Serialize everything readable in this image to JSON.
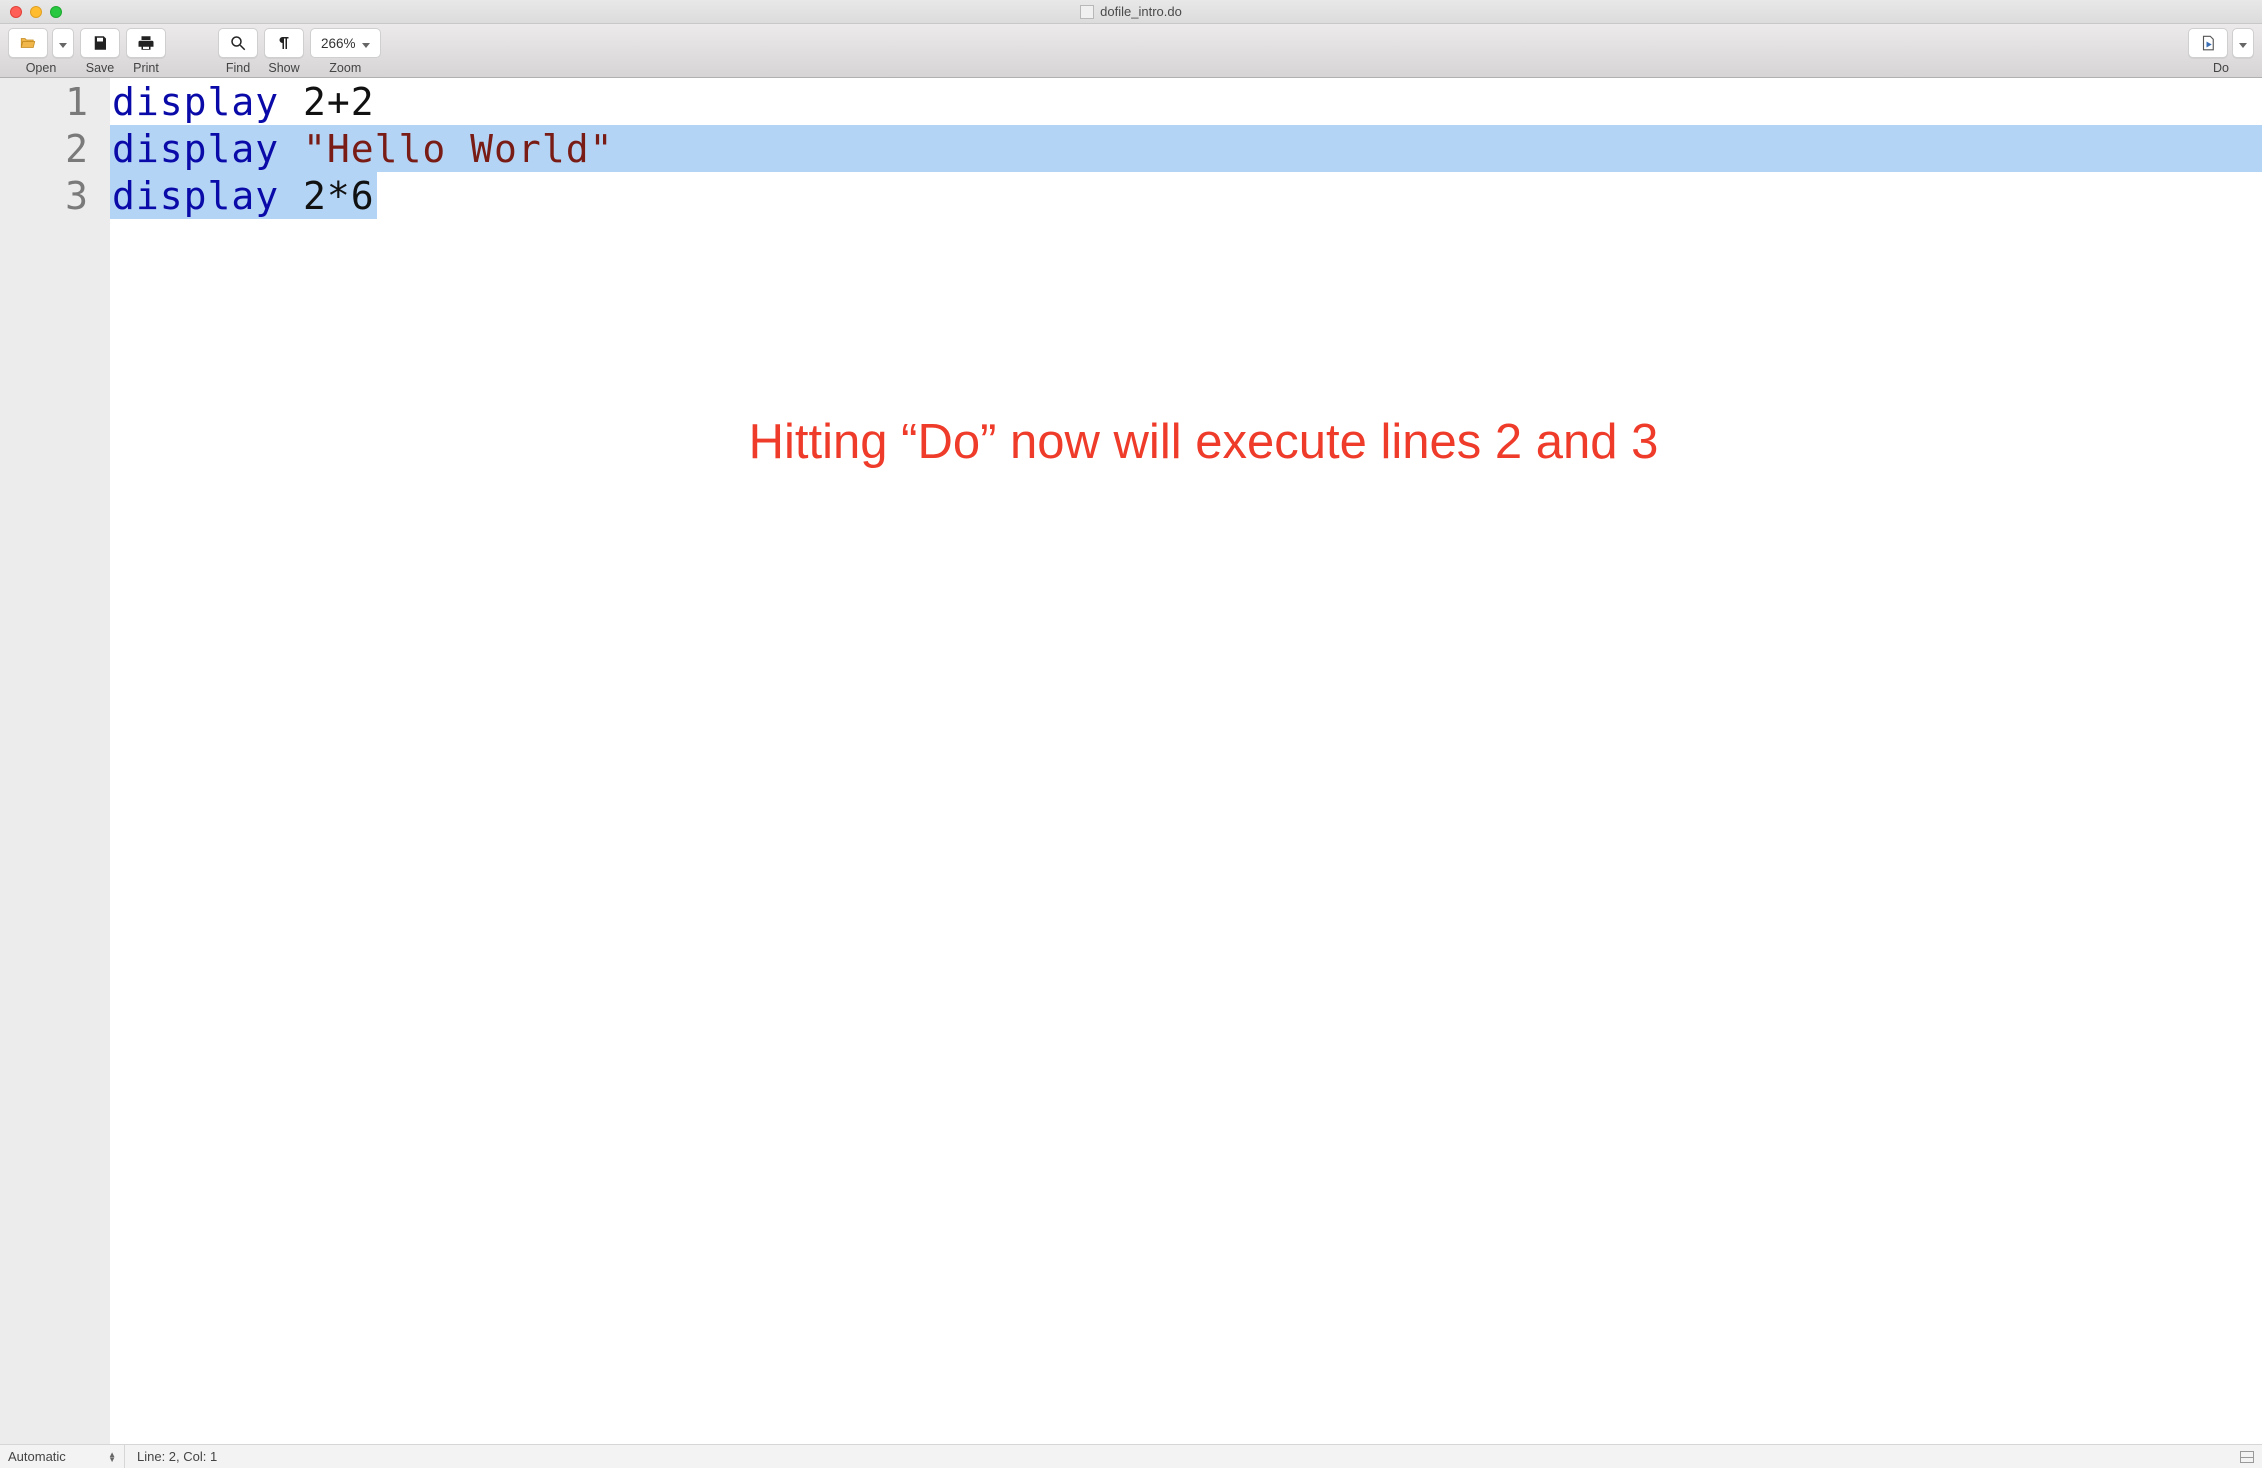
{
  "window": {
    "title": "dofile_intro.do"
  },
  "toolbar": {
    "open_label": "Open",
    "save_label": "Save",
    "print_label": "Print",
    "find_label": "Find",
    "show_label": "Show",
    "zoom_label": "Zoom",
    "zoom_value": "266%",
    "do_label": "Do"
  },
  "code": {
    "lines": [
      {
        "number": "1",
        "command": "display",
        "arg_text": " 2+2",
        "arg_type": "text",
        "selected": false,
        "partial_sel": false
      },
      {
        "number": "2",
        "command": "display",
        "arg_text": " \"Hello World\"",
        "arg_type": "string",
        "selected": true,
        "partial_sel": false
      },
      {
        "number": "3",
        "command": "display",
        "arg_text": " 2*6",
        "arg_type": "text",
        "selected": false,
        "partial_sel": true
      }
    ]
  },
  "annotation_text": "Hitting “Do” now will execute lines 2 and 3",
  "statusbar": {
    "mode": "Automatic",
    "position": "Line: 2, Col: 1"
  }
}
